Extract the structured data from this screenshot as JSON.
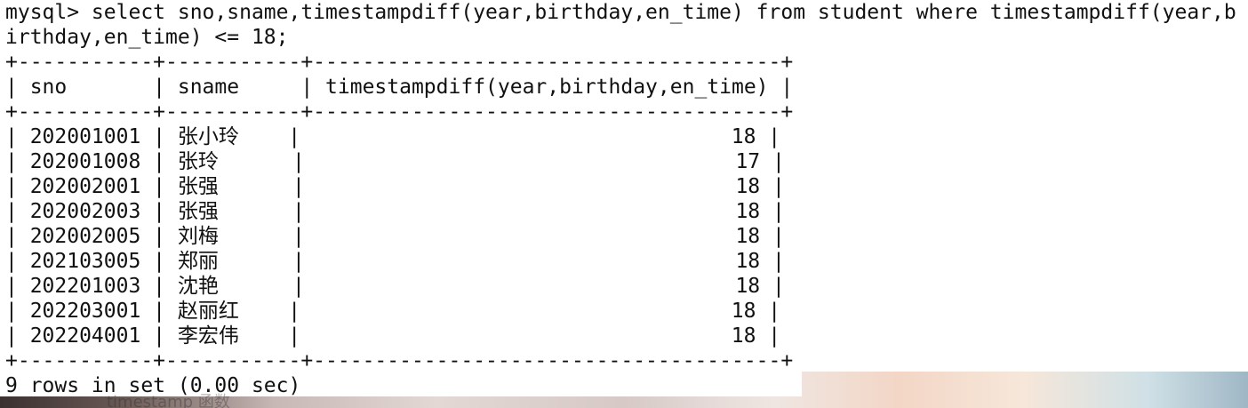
{
  "terminal": {
    "prompt_line_1": "mysql> select sno,sname,timestampdiff(year,birthday,en_time) from student where timestampdiff(year,b",
    "prompt_line_2": "irthday,en_time) <= 18;",
    "border": "+-----------+-----------+--------------------------------------+",
    "header": "| sno       | sname     | timestampdiff(year,birthday,en_time) |",
    "rows": [
      "| 202001001 | 张小玲    |                                   18 |",
      "| 202001008 | 张玲      |                                   17 |",
      "| 202002001 | 张强      |                                   18 |",
      "| 202002003 | 张强      |                                   18 |",
      "| 202002005 | 刘梅      |                                   18 |",
      "| 202103005 | 郑丽      |                                   18 |",
      "| 202201003 | 沈艳      |                                   18 |",
      "| 202203001 | 赵丽红    |                                   18 |",
      "| 202204001 | 李宏伟    |                                   18 |"
    ],
    "result_summary": "9 rows in set (0.00 sec)",
    "background_ghost_text": "timestamp    函数"
  }
}
